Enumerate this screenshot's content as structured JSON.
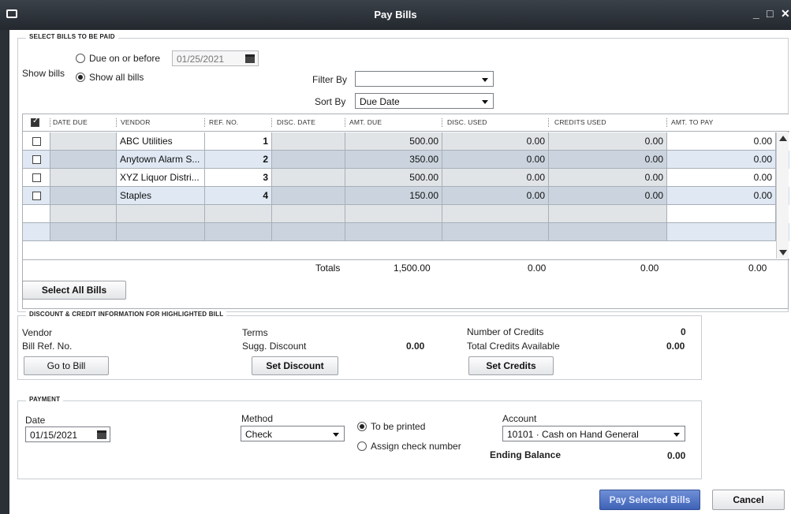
{
  "window": {
    "title": "Pay Bills",
    "controls": [
      "_",
      "□",
      "✕"
    ]
  },
  "select_bills": {
    "section_label": "SELECT BILLS TO BE PAID",
    "show_bills_label": "Show bills",
    "due_on_or_before_label": "Due on or before",
    "due_date": "01/25/2021",
    "show_all_bills_label": "Show all bills",
    "show_all_selected": true,
    "filter_by_label": "Filter By",
    "filter_by_value": "",
    "sort_by_label": "Sort By",
    "sort_by_value": "Due Date"
  },
  "table": {
    "columns": [
      "DATE DUE",
      "VENDOR",
      "REF. NO.",
      "DISC. DATE",
      "AMT. DUE",
      "DISC. USED",
      "CREDITS USED",
      "AMT. TO PAY"
    ],
    "rows": [
      {
        "date_due": "",
        "vendor": "ABC Utilities",
        "ref_no": "1",
        "disc_date": "",
        "amt_due": "500.00",
        "disc_used": "0.00",
        "credits_used": "0.00",
        "amt_to_pay": "0.00"
      },
      {
        "date_due": "",
        "vendor": "Anytown Alarm S...",
        "ref_no": "2",
        "disc_date": "",
        "amt_due": "350.00",
        "disc_used": "0.00",
        "credits_used": "0.00",
        "amt_to_pay": "0.00"
      },
      {
        "date_due": "",
        "vendor": "XYZ Liquor Distri...",
        "ref_no": "3",
        "disc_date": "",
        "amt_due": "500.00",
        "disc_used": "0.00",
        "credits_used": "0.00",
        "amt_to_pay": "0.00"
      },
      {
        "date_due": "",
        "vendor": "Staples",
        "ref_no": "4",
        "disc_date": "",
        "amt_due": "150.00",
        "disc_used": "0.00",
        "credits_used": "0.00",
        "amt_to_pay": "0.00"
      }
    ],
    "totals": {
      "label": "Totals",
      "amt_due": "1,500.00",
      "disc_used": "0.00",
      "credits_used": "0.00",
      "amt_to_pay": "0.00"
    },
    "select_all_label": "Select All Bills"
  },
  "discount_credit": {
    "section_label": "DISCOUNT & CREDIT INFORMATION FOR HIGHLIGHTED BILL",
    "vendor_label": "Vendor",
    "bill_ref_label": "Bill Ref. No.",
    "go_to_bill_label": "Go to Bill",
    "terms_label": "Terms",
    "sugg_discount_label": "Sugg. Discount",
    "sugg_discount_value": "0.00",
    "set_discount_label": "Set Discount",
    "number_of_credits_label": "Number of Credits",
    "number_of_credits_value": "0",
    "total_credits_label": "Total Credits Available",
    "total_credits_value": "0.00",
    "set_credits_label": "Set Credits"
  },
  "payment": {
    "section_label": "PAYMENT",
    "date_label": "Date",
    "date_value": "01/15/2021",
    "method_label": "Method",
    "method_value": "Check",
    "to_be_printed_label": "To be printed",
    "assign_check_label": "Assign check number",
    "to_be_printed_selected": true,
    "account_label": "Account",
    "account_value": "10101 · Cash on Hand General",
    "ending_balance_label": "Ending Balance",
    "ending_balance_value": "0.00"
  },
  "footer": {
    "pay_selected_label": "Pay Selected Bills",
    "cancel_label": "Cancel"
  }
}
